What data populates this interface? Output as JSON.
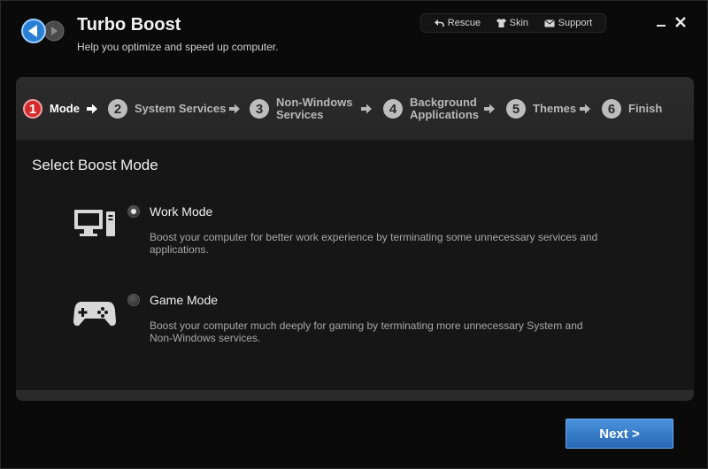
{
  "app": {
    "title": "Turbo Boost",
    "subtitle": "Help you optimize and speed up computer."
  },
  "toplinks": {
    "rescue": "Rescue",
    "skin": "Skin",
    "support": "Support"
  },
  "steps": [
    {
      "num": "1",
      "label": "Mode",
      "active": true
    },
    {
      "num": "2",
      "label": "System Services"
    },
    {
      "num": "3",
      "label": "Non-Windows",
      "label2": "Services"
    },
    {
      "num": "4",
      "label": "Background",
      "label2": "Applications"
    },
    {
      "num": "5",
      "label": "Themes"
    },
    {
      "num": "6",
      "label": "Finish"
    }
  ],
  "main": {
    "section_title": "Select Boost Mode",
    "modes": [
      {
        "title": "Work Mode",
        "selected": true,
        "icon": "computer-icon",
        "desc_line1": "Boost your computer for better work experience by terminating some unnecessary services and",
        "desc_line2": "applications."
      },
      {
        "title": "Game Mode",
        "selected": false,
        "icon": "gamepad-icon",
        "desc_line1": "Boost your computer much deeply for gaming by terminating more unnecessary System and",
        "desc_line2": "Non-Windows services."
      }
    ]
  },
  "footer": {
    "next_label": "Next >"
  },
  "colors": {
    "accent": "#2f78c6",
    "active_step": "#d42b2b"
  }
}
